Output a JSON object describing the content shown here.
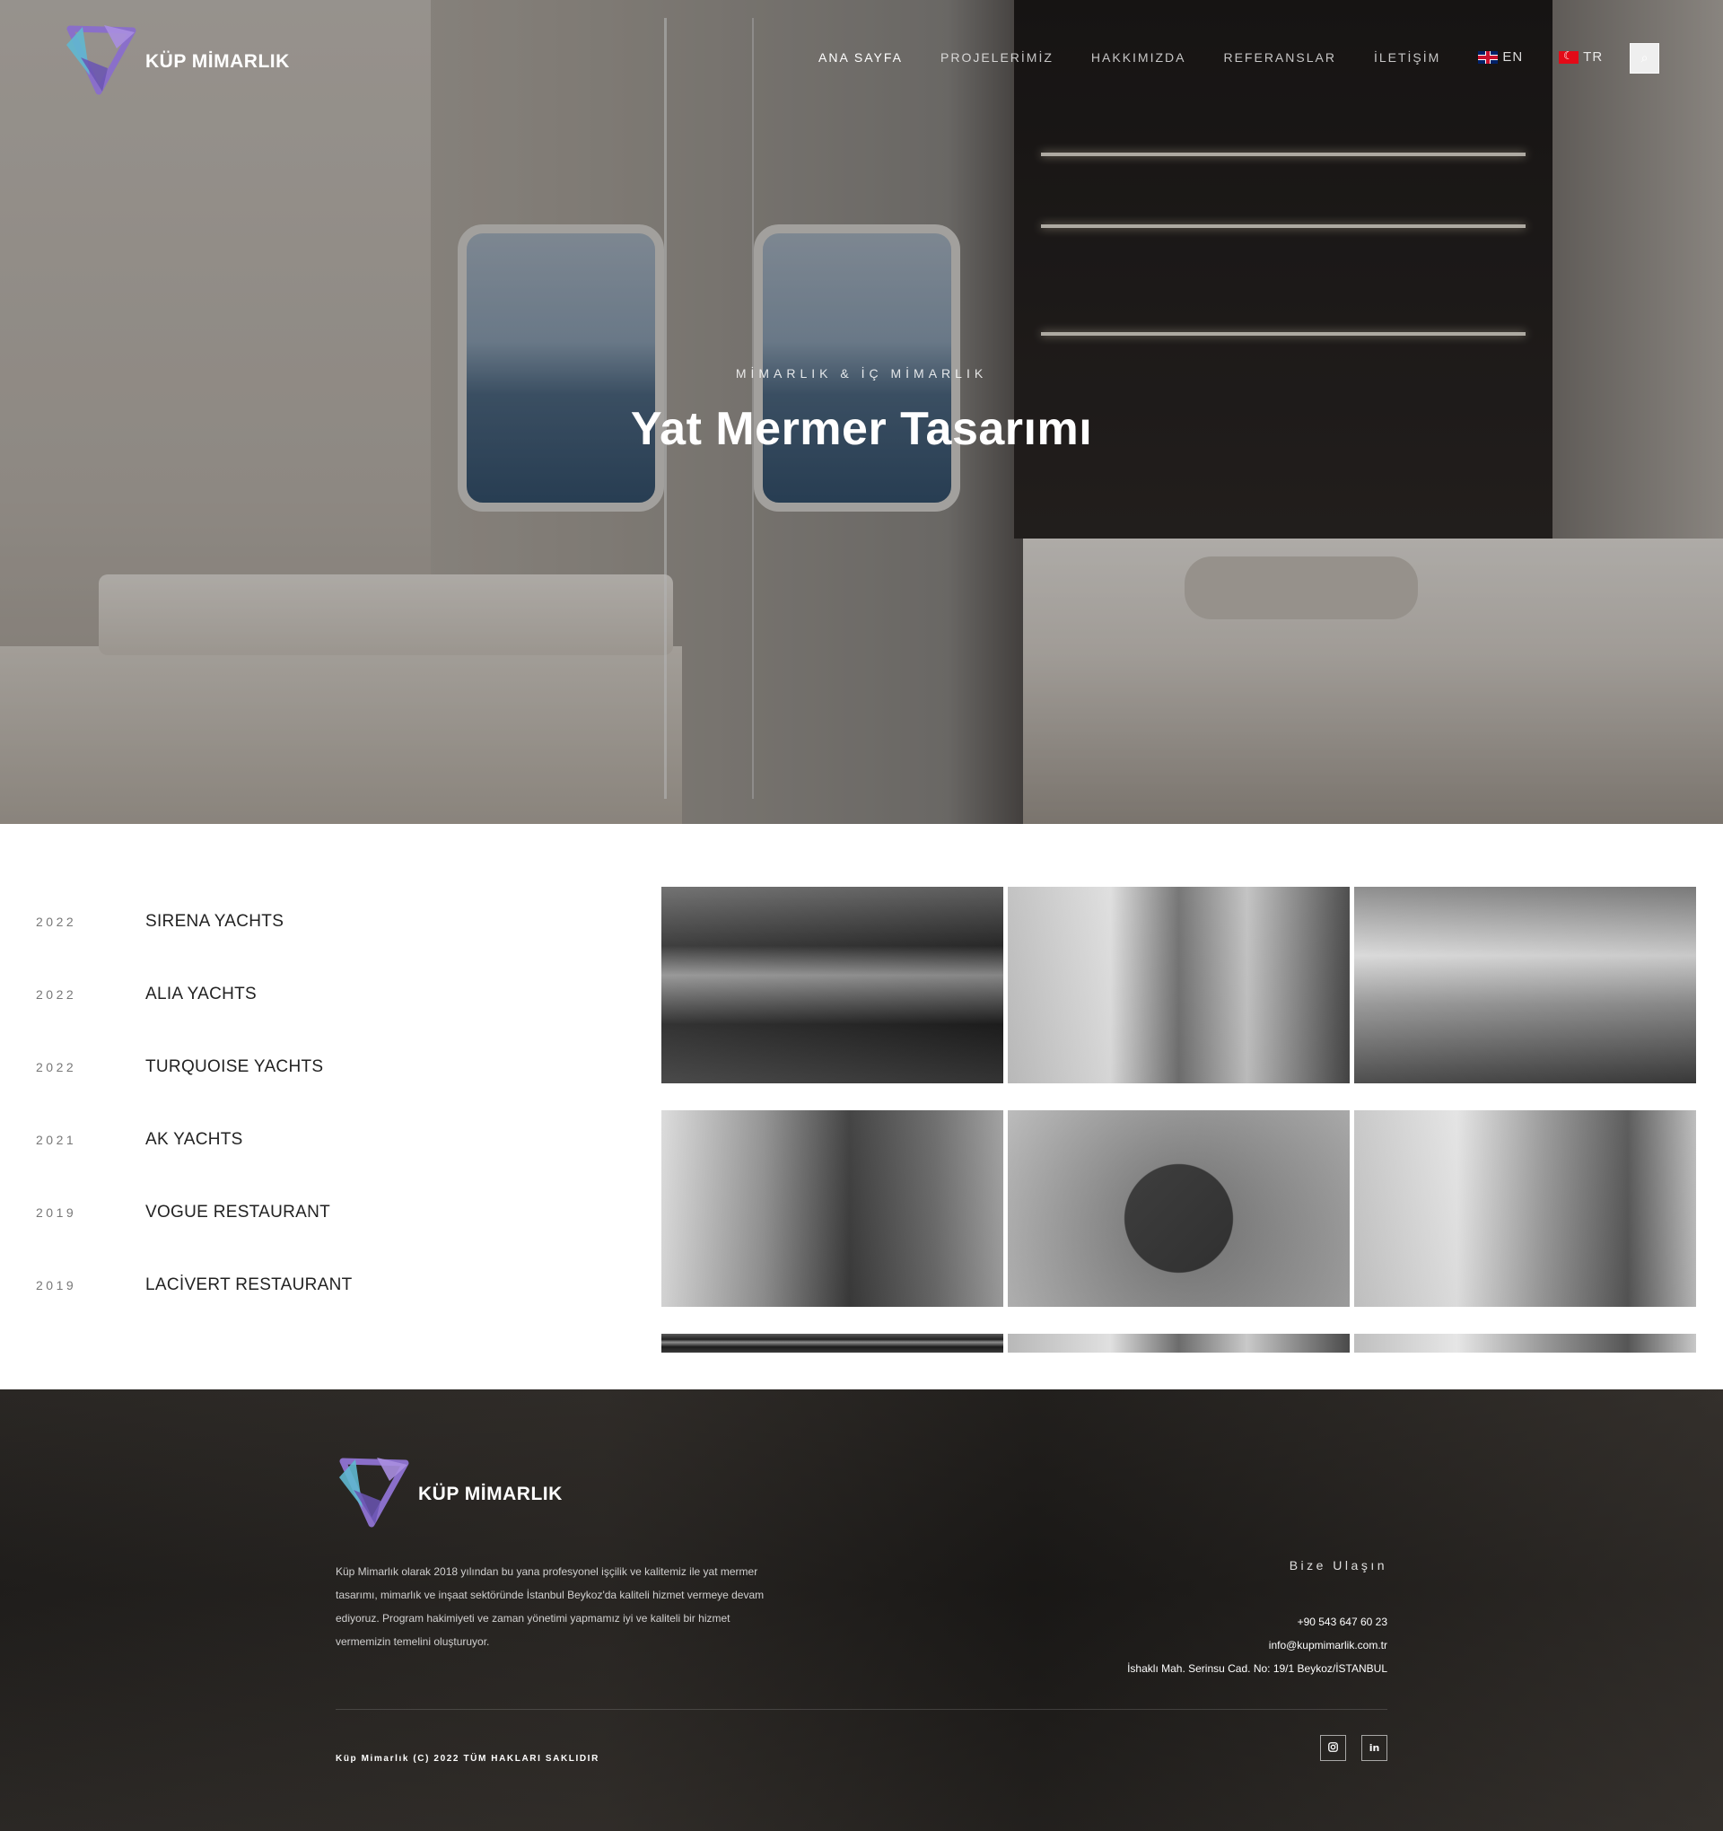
{
  "brand": {
    "name": "KÜP MİMARLIK"
  },
  "nav": {
    "items": [
      {
        "label": "ANA SAYFA",
        "active": true
      },
      {
        "label": "PROJELERİMİZ",
        "active": false
      },
      {
        "label": "HAKKIMIZDA",
        "active": false
      },
      {
        "label": "REFERANSLAR",
        "active": false
      },
      {
        "label": "İLETİŞİM",
        "active": false
      }
    ],
    "languages": [
      {
        "code": "EN",
        "icon": "uk-flag-icon"
      },
      {
        "code": "TR",
        "icon": "turkey-flag-icon"
      }
    ],
    "search_icon": "search-icon"
  },
  "hero": {
    "subtitle": "MİMARLIK & İÇ MİMARLIK",
    "title": "Yat Mermer Tasarımı"
  },
  "projects": {
    "list": [
      {
        "year": "2022",
        "name": "SIRENA YACHTS"
      },
      {
        "year": "2022",
        "name": "ALIA YACHTS"
      },
      {
        "year": "2022",
        "name": "TURQUOISE YACHTS"
      },
      {
        "year": "2021",
        "name": "AK YACHTS"
      },
      {
        "year": "2019",
        "name": "VOGUE RESTAURANT"
      },
      {
        "year": "2019",
        "name": "LACİVERT RESTAURANT"
      }
    ]
  },
  "footer": {
    "about": "Küp Mimarlık olarak 2018 yılından bu yana profesyonel işçilik ve kalitemiz ile yat mermer tasarımı, mimarlık ve inşaat sektöründe İstanbul Beykoz'da kaliteli hizmet vermeye devam ediyoruz. Program hakimiyeti ve zaman yönetimi yapmamız iyi ve kaliteli bir hizmet vermemizin temelini oluşturuyor.",
    "contact_title": "Bize Ulaşın",
    "phone": "+90 543 647 60 23",
    "email": "info@kupmimarlik.com.tr",
    "address": "İshaklı Mah. Serinsu Cad. No: 19/1 Beykoz/İSTANBUL",
    "copyright": "Küp Mimarlık (C) 2022 TÜM HAKLARI SAKLIDIR",
    "social": [
      {
        "icon": "instagram-icon"
      },
      {
        "icon": "linkedin-icon",
        "glyph": "in"
      }
    ]
  },
  "colors": {
    "logo_purple": "#8a6fc9",
    "logo_teal": "#4fb3c8",
    "footer_bg": "#24211f"
  }
}
